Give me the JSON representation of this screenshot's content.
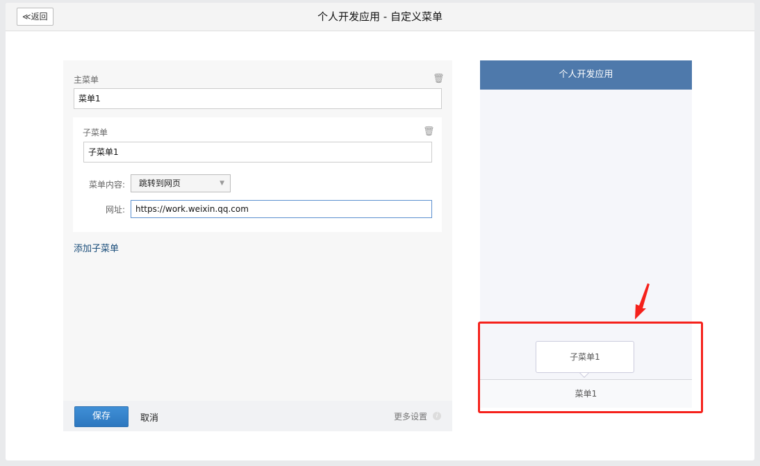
{
  "header": {
    "back_label": "≪返回",
    "title": "个人开发应用 - 自定义菜单"
  },
  "editor": {
    "main_menu_label": "主菜单",
    "main_menu_value": "菜单1",
    "sub_menu_label": "子菜单",
    "sub_menu_value": "子菜单1",
    "content_label": "菜单内容:",
    "content_value": "跳转到网页",
    "url_label": "网址:",
    "url_value": "https://work.weixin.qq.com",
    "add_sub_menu": "添加子菜单"
  },
  "footer": {
    "save": "保存",
    "cancel": "取消",
    "more": "更多设置"
  },
  "preview": {
    "app_name": "个人开发应用",
    "sub_menu_item": "子菜单1",
    "menu_item": "菜单1"
  },
  "annotation_color": "#f5211b"
}
